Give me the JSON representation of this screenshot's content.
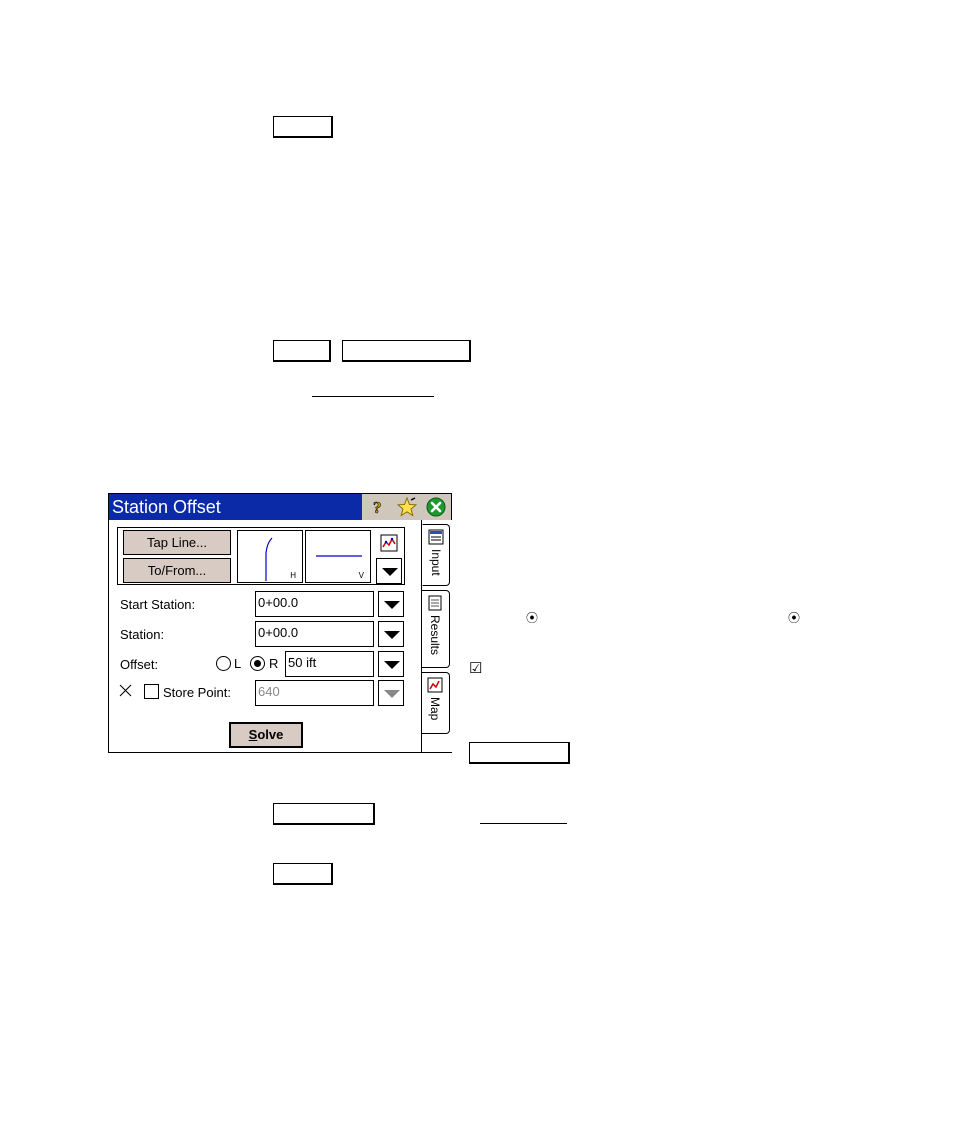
{
  "dialog": {
    "title": "Station Offset",
    "buttons": {
      "tap_line": "Tap Line...",
      "to_from": "To/From...",
      "solve_prefix": "S",
      "solve_rest": "olve"
    },
    "preview": {
      "h_label": "H",
      "v_label": "V"
    },
    "fields": {
      "start_station": {
        "label": "Start Station:",
        "value": "0+00.0"
      },
      "station": {
        "label": "Station:",
        "value": "0+00.0"
      },
      "offset": {
        "label": "Offset:",
        "radio_left": "L",
        "radio_right": "R",
        "selected": "R",
        "value": "50 ift"
      },
      "store_point": {
        "label": "Store Point:",
        "value": "640",
        "checked": false
      }
    },
    "tabs": {
      "input": "Input",
      "results": "Results",
      "map": "Map"
    },
    "colors": {
      "titlebar": "#0a2aa8",
      "button": "#d8cbc3"
    }
  },
  "icons": {
    "help": "question-mark-icon",
    "favorite": "star-icon",
    "close": "close-circle-icon"
  },
  "doc_glyphs": {
    "radio": "⦿",
    "checkbox": "☑"
  }
}
